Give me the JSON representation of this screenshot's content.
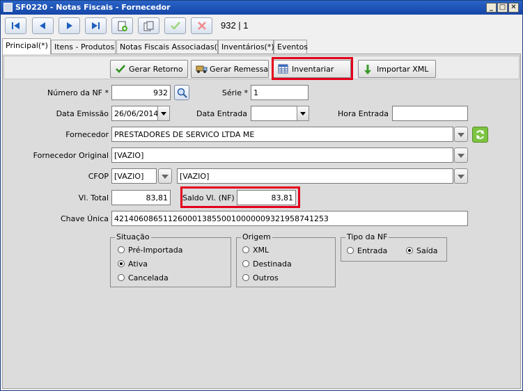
{
  "window": {
    "title": "SF0220 - Notas Fiscais - Fornecedor",
    "minimize": "_",
    "maximize": "□",
    "close": "✕"
  },
  "toolbar": {
    "record_counter": "932  |  1"
  },
  "tabs": [
    {
      "label": "Principal(*)"
    },
    {
      "label": "Itens - Produtos"
    },
    {
      "label": "Notas Fiscais Associadas(*)"
    },
    {
      "label": "Inventários(*)"
    },
    {
      "label": "Eventos"
    }
  ],
  "actions": {
    "gerar_retorno": "Gerar Retorno",
    "gerar_remessa": "Gerar Remessa",
    "inventariar": "Inventariar",
    "importar_xml": "Importar XML"
  },
  "form": {
    "numero_nf": {
      "label": "Número da NF *",
      "value": "932"
    },
    "serie": {
      "label": "Série *",
      "value": "1"
    },
    "data_emissao": {
      "label": "Data Emissão",
      "value": "26/06/2014"
    },
    "data_entrada": {
      "label": "Data Entrada",
      "value": ""
    },
    "hora_entrada": {
      "label": "Hora Entrada",
      "value": ""
    },
    "fornecedor": {
      "label": "Fornecedor",
      "value": "PRESTADORES DE SERVICO LTDA ME"
    },
    "fornecedor_original": {
      "label": "Fornecedor Original",
      "value": "[VAZIO]"
    },
    "cfop": {
      "label": "CFOP",
      "code": "[VAZIO]",
      "description": "[VAZIO]"
    },
    "vl_total": {
      "label": "Vl. Total",
      "value": "83,81"
    },
    "saldo_vl": {
      "label": "Saldo Vl. (NF)",
      "value": "83,81"
    },
    "chave_unica": {
      "label": "Chave Única",
      "value": "42140608651126000138550010000009321958741253"
    }
  },
  "situacao": {
    "legend": "Situação",
    "options": [
      "Pré-Importada",
      "Ativa",
      "Cancelada"
    ],
    "selected": "Ativa"
  },
  "origem": {
    "legend": "Origem",
    "options": [
      "XML",
      "Destinada",
      "Outros"
    ],
    "selected": ""
  },
  "tipo_nf": {
    "legend": "Tipo da NF",
    "options": [
      "Entrada",
      "Saída"
    ],
    "selected": "Saída"
  },
  "colors": {
    "title_bar": "#1646a8",
    "highlight": "#e4001b",
    "panel": "#dcdcdc"
  }
}
